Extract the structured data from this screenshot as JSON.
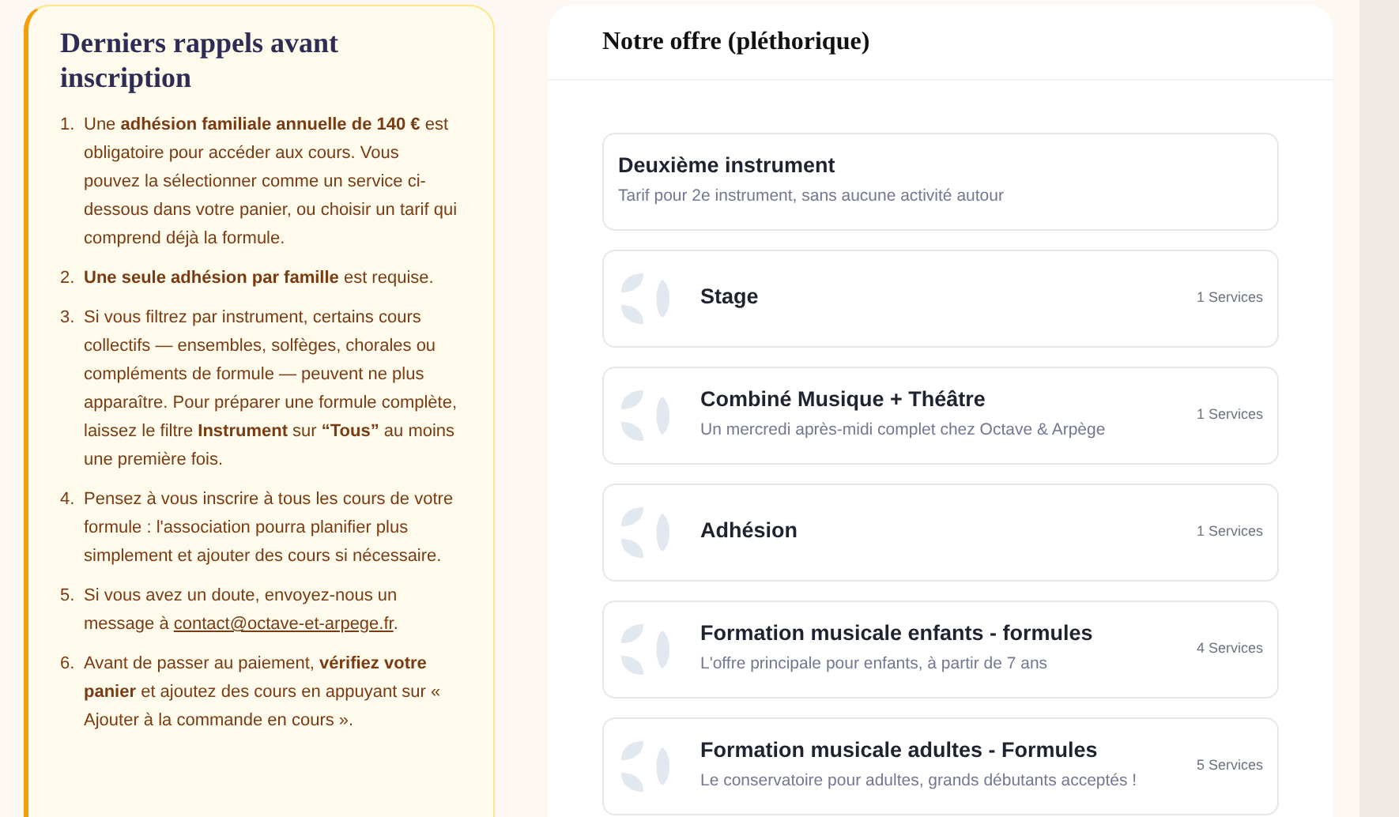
{
  "reminders": {
    "title": "Derniers rappels avant inscription",
    "items": [
      {
        "number": "1.",
        "text": "Une **adhésion familiale annuelle de 140 €** est obligatoire pour accéder aux cours. Vous pouvez la sélectionner comme un service ci-dessous dans votre panier, ou choisir un tarif qui comprend déjà la formule."
      },
      {
        "number": "2.",
        "text": "**Une seule adhésion par famille** est requise."
      },
      {
        "number": "3.",
        "text": "Si vous filtrez par instrument, certains cours collectifs — ensembles, solfèges, chorales ou compléments de formule — peuvent ne plus apparaître. Pour préparer une formule complète, laissez le filtre **Instrument** sur **“Tous”** au moins une première fois."
      },
      {
        "number": "4.",
        "text": "Pensez à vous inscrire à tous les cours de votre formule : l'association pourra planifier plus simplement et ajouter des cours si nécessaire."
      },
      {
        "number": "5.",
        "text": "Si vous avez un doute, envoyez-nous un message à",
        "link": "contact@octave-et-arpege.fr",
        "after": "."
      },
      {
        "number": "6.",
        "text": "Avant de passer au paiement, **vérifiez votre panier** et ajoutez des cours en appuyant sur « Ajouter à la commande en cours »."
      }
    ]
  },
  "offer": {
    "title": "Notre offre (pléthorique)",
    "items": [
      {
        "kind": "plain",
        "title": "Deuxième instrument",
        "subtitle": "Tarif pour 2e instrument, sans aucune activité autour"
      },
      {
        "kind": "category",
        "title": "Stage",
        "count": "1 Services"
      },
      {
        "kind": "category",
        "title": "Combiné Musique + Théâtre",
        "subtitle": "Un mercredi après-midi complet chez Octave & Arpège",
        "count": "1 Services"
      },
      {
        "kind": "category",
        "title": "Adhésion",
        "count": "1 Services"
      },
      {
        "kind": "category",
        "title": "Formation musicale enfants - formules",
        "subtitle": "L'offre principale pour enfants, à partir de 7 ans",
        "count": "4 Services"
      },
      {
        "kind": "category",
        "title": "Formation musicale adultes - Formules",
        "subtitle": "Le conservatoire pour adultes, grands débutants acceptés !",
        "count": "5 Services"
      }
    ]
  }
}
